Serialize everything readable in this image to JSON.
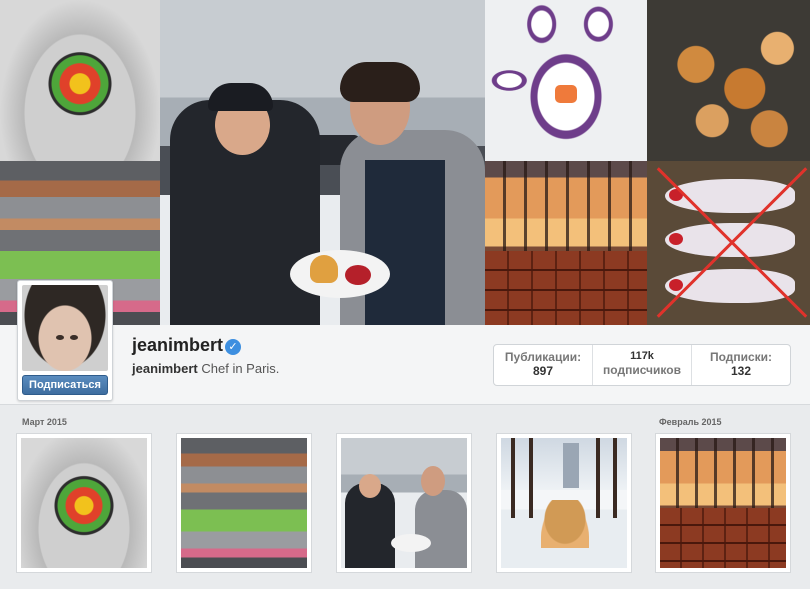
{
  "profile": {
    "username": "jeanimbert",
    "verified": true,
    "bio_username": "jeanimbert",
    "bio_text": "Chef in Paris.",
    "subscribe_label": "Подписаться",
    "verified_icon": "check-badge-icon"
  },
  "stats": {
    "posts_label": "Публикации:",
    "posts_value": "897",
    "followers_value": "117k",
    "followers_label": "подписчиков",
    "following_label": "Подписки:",
    "following_value": "132"
  },
  "grid": {
    "month_1": "Март 2015",
    "month_2": "Февраль 2015",
    "photos": [
      "hands-with-pasta",
      "kitchen",
      "chefs-in-snow",
      "pastry-in-park",
      "sunset-and-chocolate"
    ]
  },
  "colors": {
    "accent": "#3e6d9f",
    "verified": "#3d8fe0",
    "background": "#e9ebed"
  }
}
